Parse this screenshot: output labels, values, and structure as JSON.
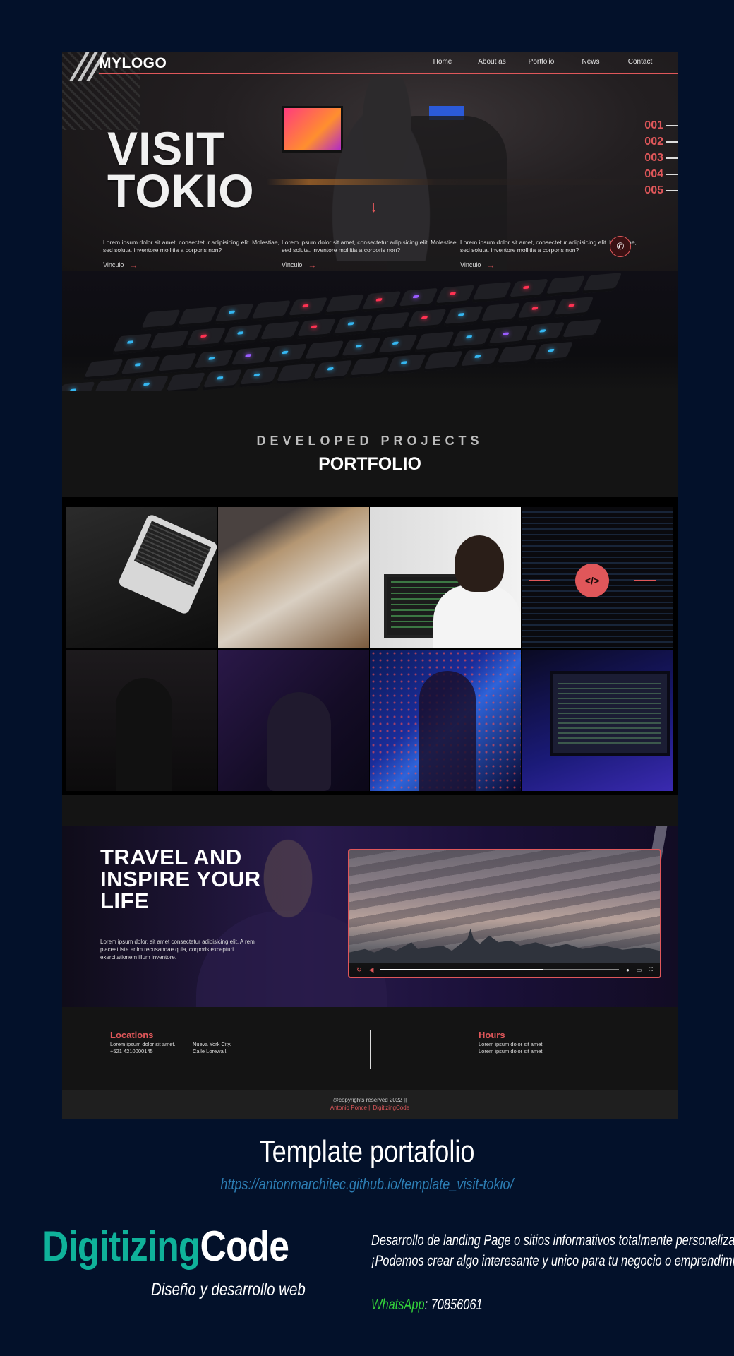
{
  "site": {
    "logo": "MYLOGO",
    "nav": [
      "Home",
      "About as",
      "Portfolio",
      "News",
      "Contact"
    ],
    "hero": {
      "title_line1": "VISIT",
      "title_line2": "TOKIO",
      "arrow": "↓",
      "slides": [
        "001",
        "002",
        "003",
        "004",
        "005"
      ],
      "columns": [
        {
          "text": "Lorem ipsum dolor sit amet, consectetur adipisicing elit. Molestiae, sed solutа. inventore mollitia a corporis non?",
          "link": "Vinculo"
        },
        {
          "text": "Lorem ipsum dolor sit amet, consectetur adipisicing elit. Molestiae, sed solutа. inventore mollitia a corporis non?",
          "link": "Vinculo"
        },
        {
          "text": "Lorem ipsum dolor sit amet, consectetur adipisicing elit. Molestiae, sed solutа. inventore mollitia a corporis non?",
          "link": "Vinculo"
        }
      ],
      "link_arrow": "→",
      "whatsapp_icon": "whatsapp-icon"
    },
    "portfolio": {
      "subtitle": "DEVELOPED PROJECTS",
      "title": "PORTFOLIO",
      "tiles": [
        "laptop-keyboard",
        "sketching-desk",
        "developer-headphones",
        "code-screen",
        "gamer-setup",
        "man-at-computer",
        "woman-code-projection",
        "monitor-code"
      ],
      "featured_icon": "code-window-icon"
    },
    "travel": {
      "title_line1": "TRAVEL AND",
      "title_line2": "INSPIRE YOUR",
      "title_line3": "LIFE",
      "text": "Lorem ipsum dolor, sit amet consectetur adipisicing elit. A rem placeat iste enim recusandae quia, corporis excepturi exercitationem illum inventore.",
      "video_progress": 0.68
    },
    "footer": {
      "locations_title": "Locations",
      "loc_a1": "Lorem ipsum dolor sit amet.",
      "loc_a2": "+521 4210000145",
      "loc_b1": "Nueva York City.",
      "loc_b2": "Calle Lorewall.",
      "hours_title": "Hours",
      "hours_1": "Lorem ipsum dolor sit amet.",
      "hours_2": "Lorem ipsum dolor sit amet.",
      "copyright": "@copyrights reserved 2022 ||",
      "credit": "Antonio Ponce || DigitizingCode"
    }
  },
  "caption": {
    "title": "Template portafolio",
    "url": "https://antonmarchitec.github.io/template_visit-tokio/"
  },
  "brand": {
    "part1": "Digitizing",
    "part2": "Code",
    "tagline": "Diseño y desarrollo web",
    "promo_line1": "Desarrollo de landing Page o sitios informativos totalmente personalizados.",
    "promo_line2": "¡Podemos crear algo interesante y unico para tu negocio o emprendimiento!",
    "whatsapp_label": "WhatsApp",
    "whatsapp_number": ": 70856061"
  },
  "colors": {
    "background": "#03112a",
    "accent": "#e0575a",
    "brand_teal": "#0fb29a",
    "url_blue": "#2c7db3",
    "whatsapp_green": "#33d33a"
  }
}
